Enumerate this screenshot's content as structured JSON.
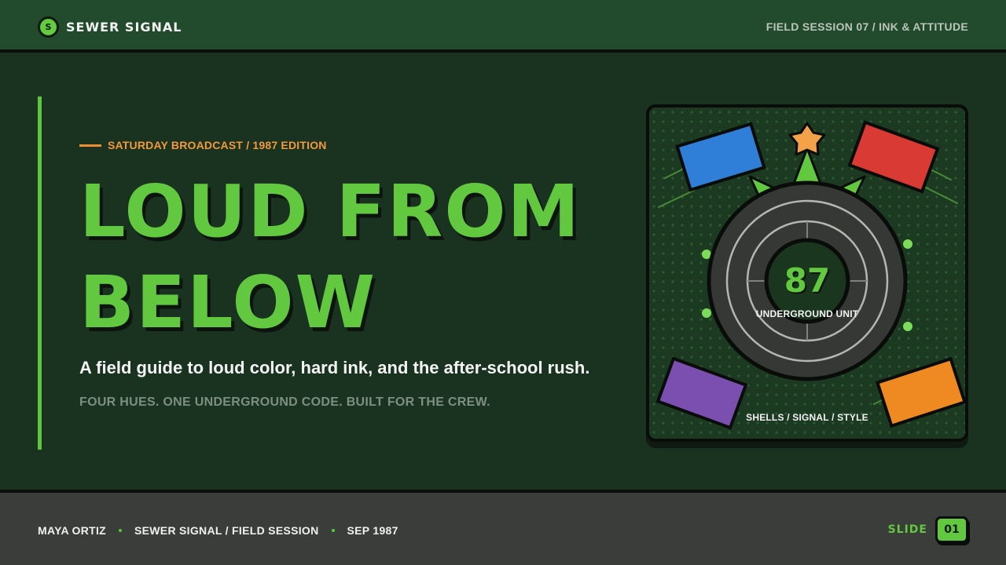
{
  "header": {
    "badge_letter": "S",
    "brand": "SEWER SIGNAL",
    "session": "FIELD SESSION 07 / INK & ATTITUDE"
  },
  "hero": {
    "eyebrow": "SATURDAY BROADCAST / 1987 EDITION",
    "headline_line1": "LOUD FROM",
    "headline_line2": "BELOW",
    "subhead": "A field guide to loud color, hard ink, and the after-school rush.",
    "tagline": "FOUR HUES. ONE UNDERGROUND CODE. BUILT FOR THE CREW."
  },
  "emblem": {
    "value": "87",
    "unit": "UNDERGROUND UNIT",
    "caption": "SHELLS / SIGNAL / STYLE",
    "swatches": {
      "blue": "#2f7fd9",
      "red": "#d93a33",
      "purple": "#7a4fb0",
      "orange": "#ef8a22"
    },
    "accent": "#62c840",
    "star": "#f4a24a"
  },
  "footer": {
    "author": "MAYA ORTIZ",
    "series": "SEWER SIGNAL / FIELD SESSION",
    "date": "SEP 1987",
    "slide_label": "SLIDE",
    "slide_number": "01"
  }
}
